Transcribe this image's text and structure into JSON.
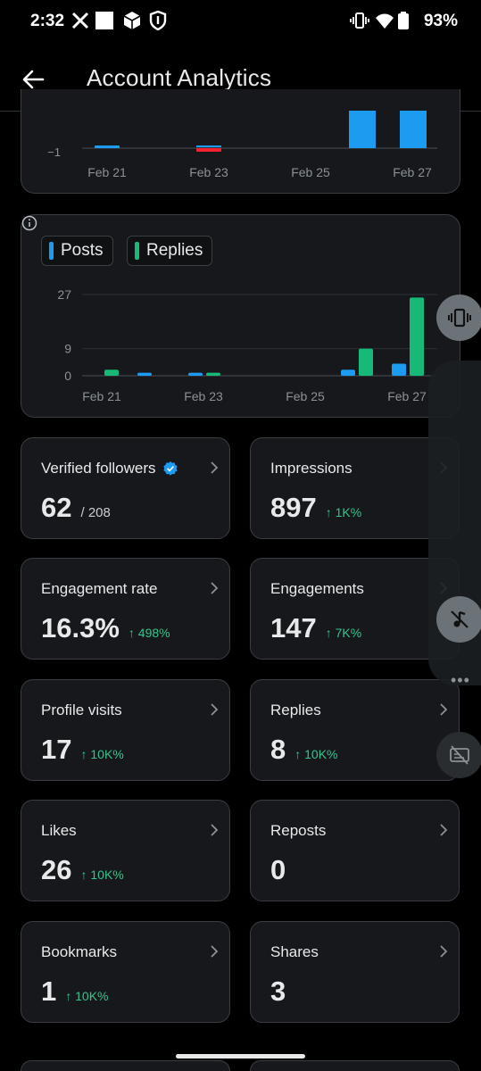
{
  "status_bar": {
    "time": "2:32",
    "battery": "93%"
  },
  "header": {
    "title": "Account Analytics"
  },
  "top_chart": {
    "y_tick": "−1",
    "x_ticks": [
      "Feb 21",
      "Feb 23",
      "Feb 25",
      "Feb 27"
    ]
  },
  "legend": {
    "posts": "Posts",
    "replies": "Replies"
  },
  "colors": {
    "posts": "#1d9bf0",
    "replies": "#17b978",
    "negative": "#f4212e",
    "positive_delta": "#35c48b",
    "verified": "#1d9bf0"
  },
  "chart_data": {
    "type": "bar",
    "categories": [
      "Feb 21",
      "Feb 22",
      "Feb 23",
      "Feb 24",
      "Feb 25",
      "Feb 26",
      "Feb 27"
    ],
    "series": [
      {
        "name": "Posts",
        "values": [
          0,
          1,
          1,
          0,
          0,
          2,
          4
        ]
      },
      {
        "name": "Replies",
        "values": [
          2,
          0,
          1,
          0,
          0,
          9,
          26
        ]
      }
    ],
    "y_ticks": [
      "27",
      "9",
      "0"
    ],
    "x_ticks": [
      "Feb 21",
      "Feb 23",
      "Feb 25",
      "Feb 27"
    ],
    "ylim": [
      0,
      27
    ],
    "legend": "top-left",
    "grid": true
  },
  "stats": [
    {
      "title": "Verified followers",
      "value": "62",
      "sub": "/ 208",
      "delta": "",
      "verified": true
    },
    {
      "title": "Impressions",
      "value": "897",
      "sub": "",
      "delta": "↑ 1K%"
    },
    {
      "title": "Engagement rate",
      "value": "16.3%",
      "sub": "",
      "delta": "↑ 498%"
    },
    {
      "title": "Engagements",
      "value": "147",
      "sub": "",
      "delta": "↑ 7K%"
    },
    {
      "title": "Profile visits",
      "value": "17",
      "sub": "",
      "delta": "↑ 10K%"
    },
    {
      "title": "Replies",
      "value": "8",
      "sub": "",
      "delta": "↑ 10K%"
    },
    {
      "title": "Likes",
      "value": "26",
      "sub": "",
      "delta": "↑ 10K%"
    },
    {
      "title": "Reposts",
      "value": "0",
      "sub": "",
      "delta": ""
    },
    {
      "title": "Bookmarks",
      "value": "1",
      "sub": "",
      "delta": "↑ 10K%"
    },
    {
      "title": "Shares",
      "value": "3",
      "sub": "",
      "delta": ""
    }
  ],
  "icons": [
    "back-arrow-icon",
    "x-logo-icon",
    "square-icon",
    "box-icon",
    "shield-icon",
    "vibrate-icon",
    "wifi-icon",
    "battery-icon",
    "info-icon",
    "chevron-right-icon",
    "verified-badge-icon",
    "music-off-icon",
    "caption-off-icon"
  ]
}
